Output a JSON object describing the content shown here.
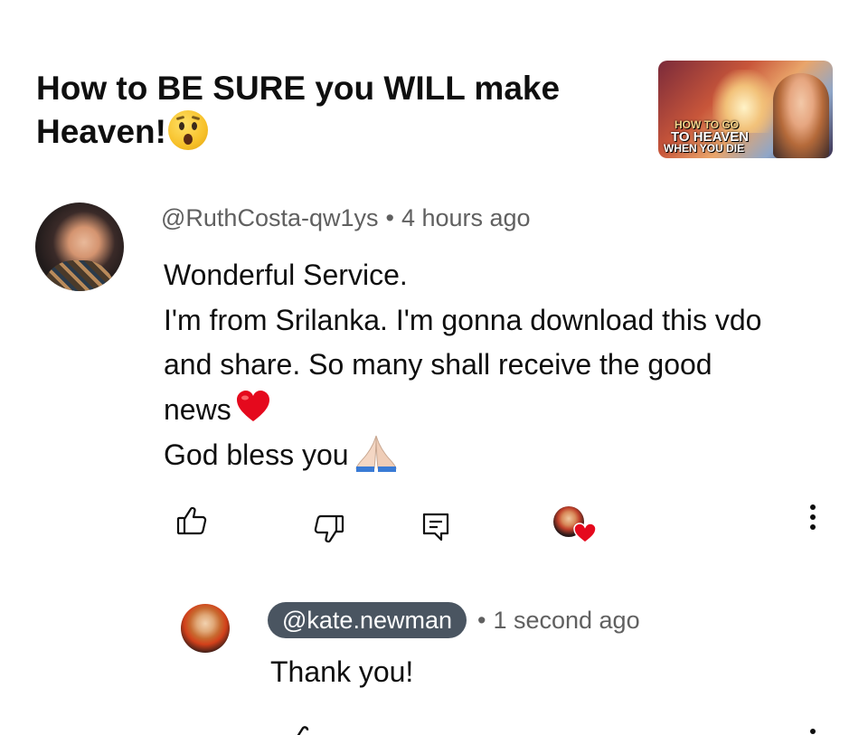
{
  "video": {
    "title": "How to BE SURE you WILL make Heaven!",
    "title_emoji": "astonished-face-emoji",
    "thumbnail": {
      "line1": "HOW TO GO",
      "line2": "TO HEAVEN",
      "line3": "WHEN YOU DIE"
    }
  },
  "comment": {
    "author": "@RuthCosta-qw1ys",
    "separator": "•",
    "time": "4 hours ago",
    "lines": [
      "Wonderful Service.",
      "I'm from Srilanka. I'm gonna download this vdo",
      "and share. So many shall receive the good",
      "news",
      "God bless you"
    ],
    "emojis": {
      "after_line_4": "red-heart-emoji",
      "after_line_5": "folded-hands-emoji"
    }
  },
  "actions": {
    "like": "thumbs-up-icon",
    "dislike": "thumbs-down-icon",
    "reply": "reply-comment-icon",
    "creator_heart": "creator-heart-badge",
    "more": "more-vertical-icon"
  },
  "reply": {
    "author": "@kate.newman",
    "separator": "•",
    "time": "1 second ago",
    "text": "Thank you!"
  },
  "colors": {
    "text": "#0f0f0f",
    "secondary": "#606060",
    "chip": "#4a5561",
    "heart": "#e5091d"
  }
}
